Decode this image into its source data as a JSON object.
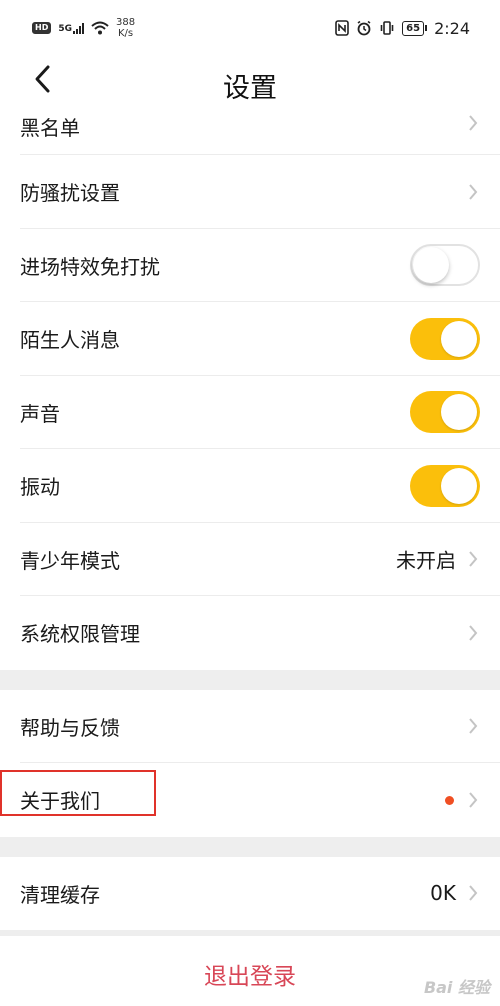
{
  "status_bar": {
    "hd": "HD",
    "network": "5G",
    "speed_value": "388",
    "speed_unit": "K/s",
    "battery": "65",
    "time": "2:24"
  },
  "header": {
    "back_icon": "chevron-left-icon",
    "title": "设置"
  },
  "settings": {
    "blacklist": "黑名单",
    "dnd_settings": "防骚扰设置",
    "entry_effect_dnd": {
      "label": "进场特效免打扰",
      "enabled": false
    },
    "stranger_messages": {
      "label": "陌生人消息",
      "enabled": true
    },
    "sound": {
      "label": "声音",
      "enabled": true
    },
    "vibration": {
      "label": "振动",
      "enabled": true
    },
    "youth_mode": {
      "label": "青少年模式",
      "value": "未开启"
    },
    "system_permissions": "系统权限管理"
  },
  "support": {
    "help_feedback": "帮助与反馈",
    "about_us": "关于我们"
  },
  "storage": {
    "clear_cache": {
      "label": "清理缓存",
      "value": "0K"
    }
  },
  "logout": "退出登录",
  "watermark": "Bai 经验",
  "colors": {
    "toggle_on": "#fbbf0b",
    "logout_text": "#d84757",
    "notification_dot": "#f04f23",
    "highlight_border": "#e0322a"
  }
}
